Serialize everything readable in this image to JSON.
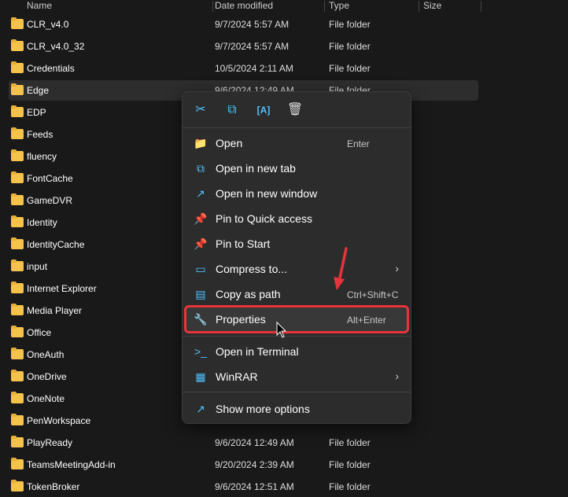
{
  "columns": [
    "Name",
    "Date modified",
    "Type",
    "Size"
  ],
  "rows": [
    {
      "name": "CLR_v4.0",
      "date": "9/7/2024 5:57 AM",
      "type": "File folder"
    },
    {
      "name": "CLR_v4.0_32",
      "date": "9/7/2024 5:57 AM",
      "type": "File folder"
    },
    {
      "name": "Credentials",
      "date": "10/5/2024 2:11 AM",
      "type": "File folder"
    },
    {
      "name": "Edge",
      "date": "9/6/2024 12:49 AM",
      "type": "File folder",
      "selected": true
    },
    {
      "name": "EDP"
    },
    {
      "name": "Feeds"
    },
    {
      "name": "fluency"
    },
    {
      "name": "FontCache"
    },
    {
      "name": "GameDVR"
    },
    {
      "name": "Identity"
    },
    {
      "name": "IdentityCache"
    },
    {
      "name": "input"
    },
    {
      "name": "Internet Explorer"
    },
    {
      "name": "Media Player"
    },
    {
      "name": "Office"
    },
    {
      "name": "OneAuth"
    },
    {
      "name": "OneDrive"
    },
    {
      "name": "OneNote"
    },
    {
      "name": "PenWorkspace"
    },
    {
      "name": "PlayReady",
      "date": "9/6/2024 12:49 AM",
      "type": "File folder"
    },
    {
      "name": "TeamsMeetingAdd-in",
      "date": "9/20/2024 2:39 AM",
      "type": "File folder"
    },
    {
      "name": "TokenBroker",
      "date": "9/6/2024 12:51 AM",
      "type": "File folder"
    }
  ],
  "menu": {
    "toolbar": [
      "cut-icon",
      "copy-icon",
      "rename-icon",
      "delete-icon"
    ],
    "items": [
      {
        "label": "Open",
        "shortcut": "Enter",
        "icon": "folder-icon"
      },
      {
        "label": "Open in new tab",
        "shortcut": "",
        "icon": "new-tab-icon"
      },
      {
        "label": "Open in new window",
        "shortcut": "",
        "icon": "new-window-icon"
      },
      {
        "label": "Pin to Quick access",
        "shortcut": "",
        "icon": "pin-icon"
      },
      {
        "label": "Pin to Start",
        "shortcut": "",
        "icon": "pin-icon"
      },
      {
        "label": "Compress to...",
        "shortcut": "",
        "icon": "zip-icon",
        "submenu": true
      },
      {
        "label": "Copy as path",
        "shortcut": "Ctrl+Shift+C",
        "icon": "path-icon"
      },
      {
        "label": "Properties",
        "shortcut": "Alt+Enter",
        "icon": "wrench-icon",
        "highlighted": true
      },
      {
        "label": "Open in Terminal",
        "shortcut": "",
        "icon": "terminal-icon"
      },
      {
        "label": "WinRAR",
        "shortcut": "",
        "icon": "winrar-icon",
        "submenu": true
      },
      {
        "label": "Show more options",
        "shortcut": "",
        "icon": "more-options-icon"
      }
    ]
  },
  "colors": {
    "accent": "#4cc2ff",
    "annotation": "#e5343b"
  }
}
